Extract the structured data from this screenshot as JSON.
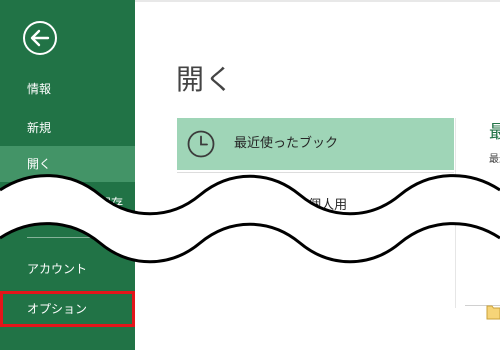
{
  "backstage": {
    "back_button": {
      "icon": "back-arrow-icon"
    },
    "nav_items": [
      {
        "label": "情報"
      },
      {
        "label": "新規"
      },
      {
        "label": "開く"
      },
      {
        "label": "名前を付けて保存"
      },
      {
        "label": "アカウント"
      },
      {
        "label": "オプション"
      }
    ]
  },
  "main": {
    "title": "開く",
    "places": [
      {
        "label": "最近使ったブック",
        "icon": "clock-icon"
      },
      {
        "label": "OneDrive - 個人用",
        "icon": "onedrive-icon"
      }
    ],
    "right_panel": {
      "heading": "最近使ったブック",
      "subheading": "最近使ったブック"
    }
  },
  "colors": {
    "sidebar": "#217346",
    "sidebar_active": "#439467",
    "place_active": "#9fd5b7",
    "highlight_outline": "#e3151a"
  }
}
